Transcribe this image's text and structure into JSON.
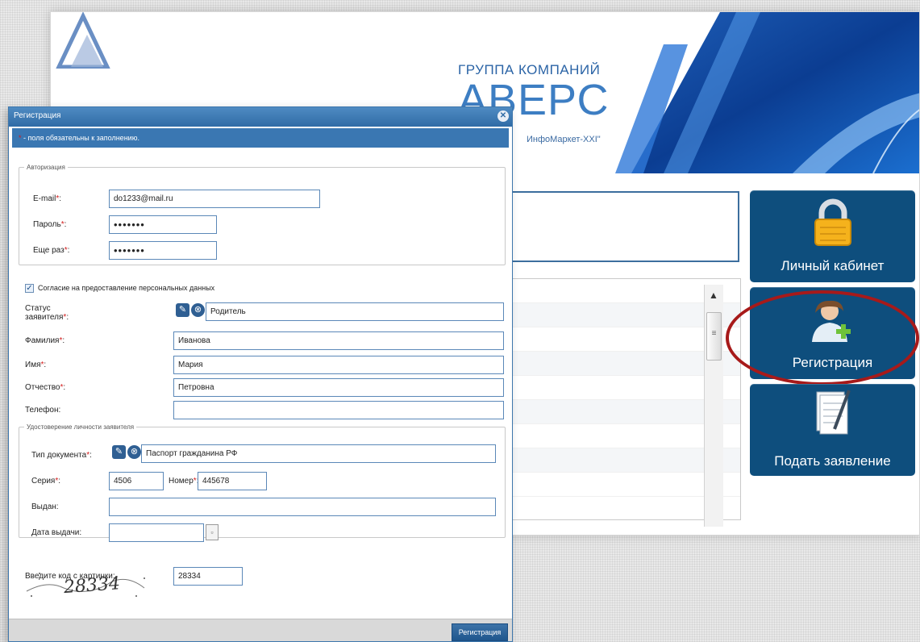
{
  "site": {
    "logo_group": "ГРУППА КОМПАНИЙ",
    "logo_name": "АВЕРС",
    "logo_sub": "ИнфоМаркет-XXI\"",
    "tiles": {
      "cabinet": "Личный кабинет",
      "register": "Регистрация",
      "apply": "Подать заявление"
    }
  },
  "dialog": {
    "title": "Регистрация",
    "required_note": "- поля обязательны к заполнению.",
    "auth_legend": "Авторизация",
    "email_label": "E-mail",
    "email_value": "do1233@mail.ru",
    "password_label": "Пароль",
    "password_value": "•••••••",
    "repeat_label": "Еще раз",
    "repeat_value": "•••••••",
    "consent_label": "Согласие на предоставление персональных данных",
    "status_label_1": "Статус",
    "status_label_2": "заявителя",
    "status_value": "Родитель",
    "surname_label": "Фамилия",
    "surname_value": "Иванова",
    "name_label": "Имя",
    "name_value": "Мария",
    "patronymic_label": "Отчество",
    "patronymic_value": "Петровна",
    "phone_label": "Телефон",
    "phone_value": "",
    "id_legend": "Удостоверение личности заявителя",
    "doctype_label": "Тип документа",
    "doctype_value": "Паспорт гражданина РФ",
    "series_label": "Серия",
    "series_value": "4506",
    "number_label": "Номер",
    "number_value": "445678",
    "issued_label": "Выдан",
    "issued_value": "",
    "issue_date_label": "Дата выдачи",
    "issue_date_value": "",
    "captcha_label": "Введите код с картинки",
    "captcha_value": "28334",
    "captcha_image_text": "28334",
    "submit": "Регистрация",
    "required_mark": "*",
    "colon": ":"
  }
}
